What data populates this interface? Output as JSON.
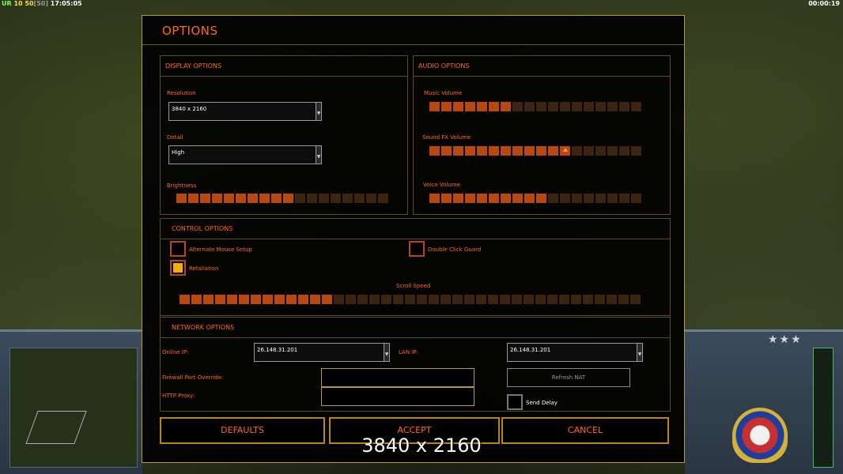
{
  "hud": {
    "rank": "UR",
    "level": "10",
    "points": "50",
    "bracket": "[50]",
    "clock": "17:05:05",
    "timer": "00:00:19"
  },
  "dialog": {
    "title": "OPTIONS",
    "display": {
      "header": "DISPLAY OPTIONS",
      "resolution_label": "Resolution",
      "resolution_value": "3840 x 2160",
      "detail_label": "Detail",
      "detail_value": "High",
      "brightness_label": "Brightness",
      "brightness_level": 0.55
    },
    "audio": {
      "header": "AUDIO OPTIONS",
      "music_label": "Music Volume",
      "music_level": 0.4,
      "sfx_label": "Sound FX Volume",
      "sfx_level": 0.65,
      "voice_label": "Voice Volume",
      "voice_level": 0.55
    },
    "control": {
      "header": "CONTROL OPTIONS",
      "alt_mouse_label": "Alternate Mouse Setup",
      "alt_mouse_checked": false,
      "double_click_label": "Double Click Guard",
      "double_click_checked": false,
      "retaliation_label": "Retaliation",
      "retaliation_checked": true,
      "scroll_label": "Scroll Speed",
      "scroll_level": 0.33
    },
    "network": {
      "header": "NETWORK OPTIONS",
      "online_ip_label": "Online IP:",
      "online_ip_value": "26.148.31.201",
      "lan_ip_label": "LAN IP:",
      "lan_ip_value": "26.148.31.201",
      "firewall_label": "Firewall Port Override:",
      "firewall_value": "",
      "proxy_label": "HTTP Proxy:",
      "proxy_value": "",
      "refresh_nat_label": "Refresh NAT",
      "send_delay_label": "Send Delay",
      "send_delay_checked": false
    },
    "buttons": {
      "defaults": "DEFAULTS",
      "accept": "ACCEPT",
      "cancel": "CANCEL"
    }
  },
  "overlay_caption": "3840 x 2160",
  "colors": {
    "accent": "#ff6a1a",
    "border": "#b89a2a",
    "slider_on": "#b8480e",
    "slider_off": "#3d2410",
    "check": "#f0b000"
  }
}
